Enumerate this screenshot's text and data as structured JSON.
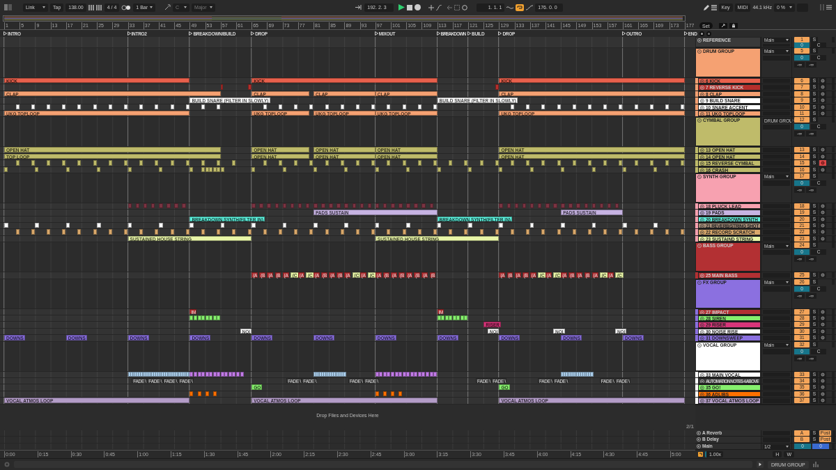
{
  "toolbar": {
    "link": "Link",
    "tap": "Tap",
    "tempo": "138.00",
    "signature": "4 / 4",
    "quantize": "1 Bar",
    "key": "C",
    "scale": "Major",
    "position": "192. 2. 3",
    "loop_start": "1. 1. 1",
    "loop_on": true,
    "loop_length": "176. 0. 0",
    "key_map": "Key",
    "midi_map": "MIDI",
    "sample_rate": "44.1 kHz",
    "cpu": "0 %"
  },
  "ruler": {
    "bars": [
      "1",
      "5",
      "9",
      "13",
      "17",
      "21",
      "25",
      "29",
      "33",
      "37",
      "41",
      "45",
      "49",
      "53",
      "57",
      "61",
      "65",
      "69",
      "73",
      "77",
      "81",
      "85",
      "89",
      "93",
      "97",
      "101",
      "105",
      "109",
      "113",
      "117",
      "121",
      "125",
      "129",
      "133",
      "137",
      "141",
      "145",
      "149",
      "153",
      "157",
      "161",
      "165",
      "169",
      "173",
      "177"
    ],
    "set": "Set"
  },
  "locators": [
    {
      "name": "INTRO"
    },
    {
      "name": "INTRO2"
    },
    {
      "name": "BREAKDOWN/BUILD"
    },
    {
      "name": "DROP"
    },
    {
      "name": "MIXOUT"
    },
    {
      "name": "BREAKDOWN"
    },
    {
      "name": "BUILD"
    },
    {
      "name": "DROP"
    },
    {
      "name": "OUTRO"
    },
    {
      "name": "END"
    }
  ],
  "tracks": [
    {
      "kind": "reference",
      "name": "REFERENCE",
      "color": "#3a3a3a",
      "number": "1",
      "solo": "S",
      "output": "Main",
      "pan": "0",
      "pan_mode": "C"
    },
    {
      "kind": "group",
      "name": "DRUM GROUP",
      "color": "#f5a172",
      "number": "5",
      "solo": "S",
      "output": "Main",
      "pan": "0",
      "pan_mode": "C",
      "peaks": [
        "-∞",
        "-∞"
      ],
      "children": [
        {
          "name": "6 KICK",
          "color": "#e8604c",
          "number": "6",
          "solo": "S",
          "armed": false,
          "clips": [
            {
              "name": "KICK"
            },
            {
              "name": "KICK"
            },
            {
              "name": "KICK"
            }
          ]
        },
        {
          "name": "7 REVERSE KICK",
          "color": "#b52f2c",
          "number": "7",
          "solo": "S",
          "armed": false
        },
        {
          "name": "8 CLAP",
          "color": "#f5a172",
          "number": "8",
          "solo": "S",
          "armed": false,
          "clips": [
            {
              "name": "CLAP"
            },
            {
              "name": "CLAP"
            },
            {
              "name": "CLAP"
            },
            {
              "name": "CLAP"
            },
            {
              "name": "CLAP"
            }
          ]
        },
        {
          "name": "9 BUILD SNARE",
          "color": "#ffffff",
          "number": "9",
          "solo": "S",
          "armed": false,
          "clips": [
            {
              "name": "BUILD SNARE (FILTER IN SLOWLY)"
            },
            {
              "name": "BUILD SNARE (FILTER IN SLOWLY)"
            }
          ]
        },
        {
          "name": "10 SNARE ACCENT",
          "color": "#ffffff",
          "number": "10",
          "solo": "S",
          "armed": false
        },
        {
          "name": "11 UKG TOPLOOP",
          "color": "#f5a172",
          "number": "11",
          "solo": "S",
          "armed": false,
          "clips": [
            {
              "name": "UKG TOPLOOP"
            },
            {
              "name": "UKG TOPLOOP"
            },
            {
              "name": "UKG TOPLOOP"
            },
            {
              "name": "UKG TOPLOOP"
            },
            {
              "name": "UKG TOPLOOP"
            }
          ]
        }
      ]
    },
    {
      "kind": "group",
      "name": "CYMBAL GROUP",
      "color": "#bfbb6a",
      "number": "12",
      "solo": "S",
      "output": "DRUM GROU",
      "pan": "0",
      "pan_mode": "C",
      "peaks": [
        "-∞",
        "-∞"
      ],
      "children": [
        {
          "name": "13 OPEN HAT",
          "color": "#bfbb6a",
          "number": "13",
          "solo": "S",
          "armed": false,
          "clips": [
            {
              "name": "OPEN HAT"
            },
            {
              "name": "OPEN HAT"
            },
            {
              "name": "OPEN HAT"
            },
            {
              "name": "OPEN HAT"
            },
            {
              "name": "OPEN HAT"
            }
          ]
        },
        {
          "name": "14 OPEN HAT",
          "color": "#bfbb6a",
          "number": "14",
          "solo": "S",
          "armed": false,
          "clips": [
            {
              "name": "TOP LOOP"
            },
            {
              "name": "OPEN HAT"
            },
            {
              "name": "OPEN HAT"
            },
            {
              "name": "OPEN HAT"
            },
            {
              "name": "OPEN HAT"
            }
          ]
        },
        {
          "name": "15 REVERSE CYMBAL",
          "color": "#bfbb6a",
          "number": "15",
          "solo": "S",
          "armed": true
        },
        {
          "name": "16 CRASH",
          "color": "#bfbb6a",
          "number": "16",
          "solo": "S",
          "armed": false
        }
      ]
    },
    {
      "kind": "group",
      "name": "SYNTH GROUP",
      "color": "#f7a1b0",
      "number": "17",
      "solo": "S",
      "output": "Main",
      "pan": "0",
      "pan_mode": "C",
      "peaks": [
        "-∞",
        "-∞"
      ],
      "children": [
        {
          "name": "18 PLUCK LEAD",
          "color": "#f7a1b0",
          "number": "18",
          "solo": "S",
          "armed": false
        },
        {
          "name": "19 PADS",
          "color": "#c6b3e2",
          "number": "19",
          "solo": "S",
          "armed": false,
          "clips": [
            {
              "name": "PADS SUSTAIN"
            },
            {
              "name": "PADS SUSTAIN"
            }
          ]
        },
        {
          "name": "20 BREAKDOWN SYNTH",
          "color": "#5ef2de",
          "number": "20",
          "solo": "S",
          "armed": false,
          "clips": [
            {
              "name": "BREAKDOWN SYNTH(FILTER IN)"
            },
            {
              "name": "BREAKDOWN SYNTH(FILTER IN)"
            }
          ]
        },
        {
          "name": "21 REVERB/STRING SHOT",
          "color": "#a68d78",
          "number": "21",
          "solo": "S",
          "armed": false
        },
        {
          "name": "22 RECORD SCRATCH",
          "color": "#d9a86b",
          "number": "22",
          "solo": "S",
          "armed": false
        },
        {
          "name": "23 SUSTAIND STRING",
          "color": "#e9f6a8",
          "number": "23",
          "solo": "S",
          "armed": false,
          "clips": [
            {
              "name": "SUSTAINED HOUSE STRING"
            },
            {
              "name": "SUSTAINED HOUSE STRING"
            }
          ]
        }
      ]
    },
    {
      "kind": "group",
      "name": "BASS GROUP",
      "color": "#b33033",
      "number": "24",
      "solo": "S",
      "output": "Main",
      "pan": "0",
      "pan_mode": "C",
      "peaks": [
        "-∞",
        "-∞"
      ],
      "children": [
        {
          "name": "25 MAIN BASS",
          "color": "#b33033",
          "number": "25",
          "solo": "S",
          "armed": false,
          "clips": [
            {
              "name": "(A"
            },
            {
              "name": "(B"
            },
            {
              "name": "(A"
            },
            {
              "name": "(B"
            },
            {
              "name": "(A"
            },
            {
              "name": "(C",
              "color": "#e9f6a8"
            },
            {
              "name": "(A"
            },
            {
              "name": "(C",
              "color": "#e9f6a8"
            },
            {
              "name": "(A"
            },
            {
              "name": "(B"
            },
            {
              "name": "(A"
            },
            {
              "name": "(B"
            },
            {
              "name": "(A"
            },
            {
              "name": "(C",
              "color": "#e9f6a8"
            },
            {
              "name": "(A"
            },
            {
              "name": "(C",
              "color": "#e9f6a8"
            },
            {
              "name": "(A"
            },
            {
              "name": "(B"
            },
            {
              "name": "(A"
            },
            {
              "name": "(B"
            },
            {
              "name": "(A"
            },
            {
              "name": "(B"
            },
            {
              "name": "(A"
            },
            {
              "name": "(B"
            },
            {
              "name": "(A"
            },
            {
              "name": "(B"
            },
            {
              "name": "(A"
            },
            {
              "name": "(B"
            },
            {
              "name": "(A"
            },
            {
              "name": "(C",
              "color": "#e9f6a8"
            },
            {
              "name": "(A"
            },
            {
              "name": "(C",
              "color": "#e9f6a8"
            },
            {
              "name": "(A"
            },
            {
              "name": "(B"
            },
            {
              "name": "(A"
            },
            {
              "name": "(B"
            },
            {
              "name": "(A"
            },
            {
              "name": "(C",
              "color": "#e9f6a8"
            },
            {
              "name": "(A"
            },
            {
              "name": "(C",
              "color": "#e9f6a8"
            }
          ]
        }
      ]
    },
    {
      "kind": "group",
      "name": "FX GROUP",
      "color": "#8b70e0",
      "number": "26",
      "solo": "S",
      "output": "Main",
      "pan": "0",
      "pan_mode": "C",
      "peaks": [
        "-∞",
        "-∞"
      ],
      "children": [
        {
          "name": "27 IMPACT",
          "color": "#b33033",
          "number": "27",
          "solo": "S",
          "armed": false,
          "clips": [
            {
              "name": "IM"
            },
            {
              "name": "IM"
            }
          ]
        },
        {
          "name": "28 SIREN",
          "color": "#86ef6d",
          "number": "28",
          "solo": "S",
          "armed": false
        },
        {
          "name": "29 RISER",
          "color": "#d8357a",
          "number": "29",
          "solo": "S",
          "armed": false,
          "clips": [
            {
              "name": "RISER"
            }
          ]
        },
        {
          "name": "30 NOISE RISE",
          "color": "#ffffff",
          "number": "30",
          "solo": "S",
          "armed": false,
          "clips": [
            {
              "name": "NOI"
            },
            {
              "name": "NOI"
            },
            {
              "name": "NOI"
            },
            {
              "name": "NOI"
            }
          ]
        },
        {
          "name": "31 DOWNSWEEP",
          "color": "#8b70e0",
          "number": "31",
          "solo": "S",
          "armed": false,
          "clips": [
            {
              "name": "DOWNS"
            },
            {
              "name": "DOWNS"
            },
            {
              "name": "DOWNS"
            },
            {
              "name": "DOWNS"
            },
            {
              "name": "DOWNS"
            },
            {
              "name": "DOWNS"
            },
            {
              "name": "DOWNS"
            },
            {
              "name": "DOWNS"
            },
            {
              "name": "DOWNS"
            },
            {
              "name": "DOWNS"
            },
            {
              "name": "DOWNS"
            }
          ]
        }
      ]
    },
    {
      "kind": "group",
      "name": "VOCAL GROUP",
      "color": "#ffffff",
      "number": "32",
      "solo": "S",
      "output": "Main",
      "pan": "0",
      "pan_mode": "C",
      "peaks": [
        "-∞",
        "-∞"
      ],
      "children": [
        {
          "name": "33 MAIN VOCAL",
          "color": "#ffffff",
          "number": "33",
          "solo": "S",
          "armed": false
        },
        {
          "name": "AUTOMATION NOTES 4 ABOVE",
          "color": "#3a3a3a",
          "number": "34",
          "solo": "S",
          "armed": false,
          "clips": [
            {
              "name": "FADE \\"
            },
            {
              "name": "FADE \\"
            },
            {
              "name": "FADE \\"
            },
            {
              "name": "FADE \\"
            },
            {
              "name": "FADE \\"
            },
            {
              "name": "FADE \\"
            },
            {
              "name": "FADE \\"
            },
            {
              "name": "FADE \\"
            },
            {
              "name": "FADE \\"
            },
            {
              "name": "FADE \\"
            },
            {
              "name": "FADE \\"
            },
            {
              "name": "FADE \\"
            },
            {
              "name": "FADE \\"
            },
            {
              "name": "FADE \\"
            }
          ]
        },
        {
          "name": "35 GO!",
          "color": "#86ef6d",
          "number": "35",
          "solo": "S",
          "armed": false,
          "clips": [
            {
              "name": "GO"
            },
            {
              "name": "GO"
            }
          ]
        },
        {
          "name": "36 ADLIBS",
          "color": "#ff7000",
          "number": "36",
          "solo": "S",
          "armed": false
        },
        {
          "name": "37 VOCAL ATMOS LOOP",
          "color": "#b39cc7",
          "number": "37",
          "solo": "S",
          "armed": false,
          "clips": [
            {
              "name": "VOCAL ATMOS LOOP"
            },
            {
              "name": "VOCAL ATMOS LOOP"
            },
            {
              "name": "VOCAL ATMOS LOOP"
            }
          ]
        }
      ]
    }
  ],
  "drop_hint": "Drop Files and Devices Here",
  "grid": "2/1",
  "returns": [
    {
      "kind": "return",
      "name": "A Reverb",
      "number": "A",
      "solo": "S",
      "send": "Post"
    },
    {
      "kind": "return",
      "name": "B Delay",
      "number": "B",
      "solo": "S",
      "send": "Post"
    },
    {
      "kind": "main",
      "name": "Main",
      "output": "1/2",
      "pan": "0",
      "volume": "0"
    }
  ],
  "times": [
    "0:00",
    "0:15",
    "0:30",
    "0:45",
    "1:00",
    "1:15",
    "1:30",
    "1:45",
    "2:00",
    "2:15",
    "2:30",
    "2:45",
    "3:00",
    "3:15",
    "3:30",
    "3:45",
    "4:00",
    "4:15",
    "4:30",
    "4:45",
    "5:00"
  ],
  "zoom": {
    "value": "1.00x",
    "h": "H",
    "w": "W"
  },
  "status": {
    "selected_track": "DRUM GROUP"
  }
}
